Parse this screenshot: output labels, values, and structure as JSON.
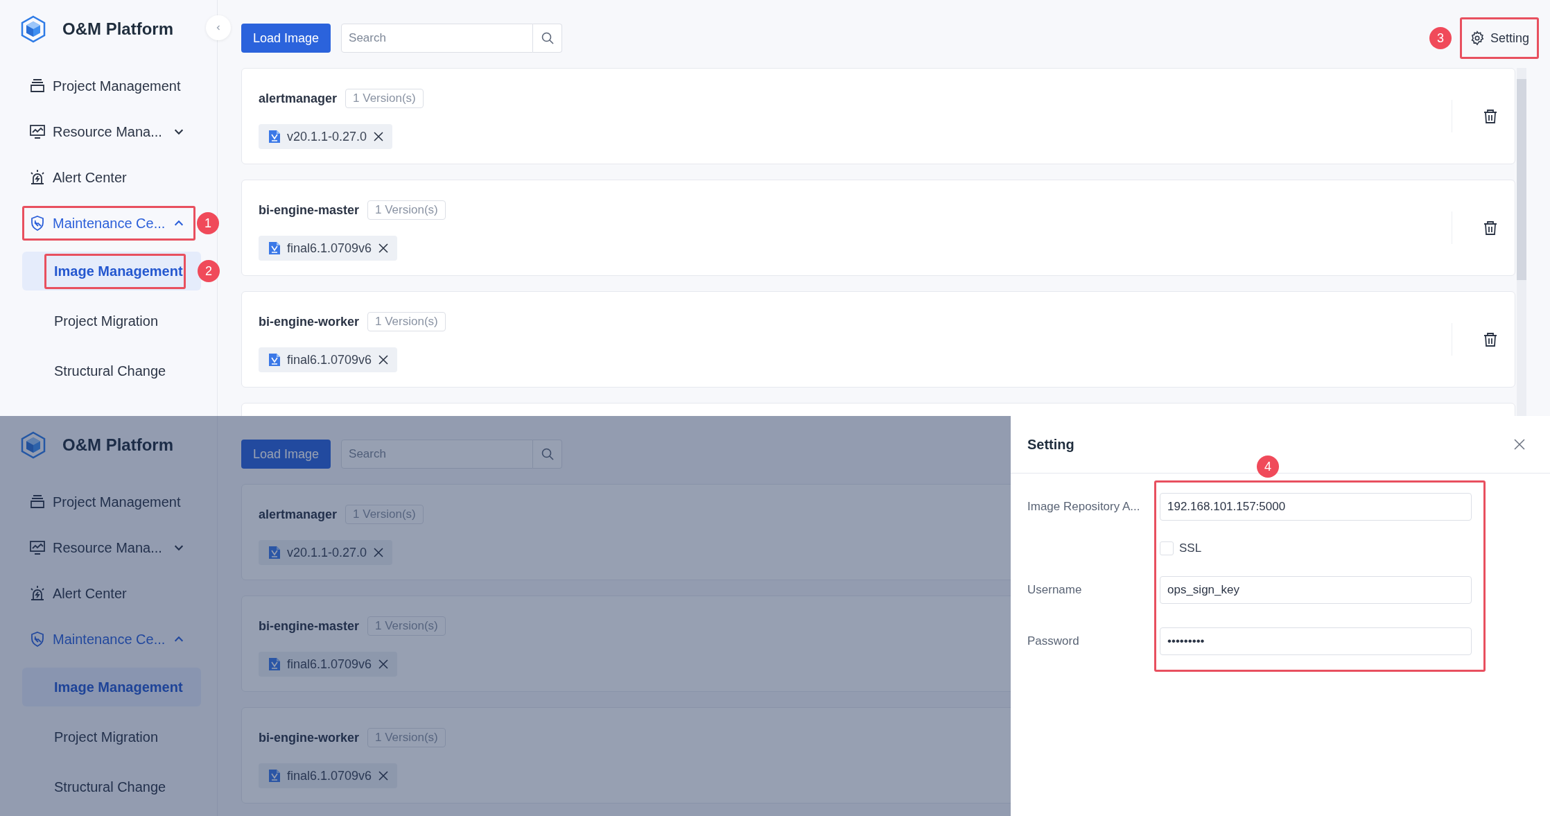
{
  "screens": [
    {
      "sidebar": {
        "title": "O&M Platform",
        "collapse_button": true,
        "menu": [
          {
            "kind": "link",
            "label": "Project Management"
          },
          {
            "kind": "group",
            "label": "Resource Mana...",
            "expanded": false
          },
          {
            "kind": "link",
            "label": "Alert Center"
          },
          {
            "kind": "group",
            "label": "Maintenance Ce...",
            "expanded": true,
            "callout": "1",
            "children": [
              {
                "label": "Image Management",
                "selected": true,
                "callout": "2"
              },
              {
                "label": "Project Migration",
                "selected": false
              },
              {
                "label": "Structural Change",
                "selected": false
              }
            ]
          }
        ]
      },
      "toolbar": {
        "load_button": "Load Image",
        "search_placeholder": "Search",
        "setting_button": {
          "label": "Setting",
          "callout": "3"
        }
      },
      "images": [
        {
          "kind": "image",
          "name": "alertmanager",
          "tag": "1 Version(s)",
          "versions": [
            "v20.1.1-0.27.0"
          ]
        },
        {
          "kind": "image",
          "name": "bi-engine-master",
          "tag": "1 Version(s)",
          "versions": [
            "final6.1.0709v6"
          ]
        },
        {
          "kind": "image",
          "name": "bi-engine-worker",
          "tag": "1 Version(s)",
          "versions": [
            "final6.1.0709v6"
          ]
        },
        {
          "kind": "empty"
        }
      ]
    },
    {
      "sidebar": {
        "title": "O&M Platform",
        "collapse_button": false,
        "menu": [
          {
            "kind": "link",
            "label": "Project Management"
          },
          {
            "kind": "group",
            "label": "Resource Mana...",
            "expanded": false
          },
          {
            "kind": "link",
            "label": "Alert Center"
          },
          {
            "kind": "group",
            "label": "Maintenance Ce...",
            "expanded": true,
            "children": [
              {
                "label": "Image Management",
                "selected": true
              },
              {
                "label": "Project Migration",
                "selected": false
              },
              {
                "label": "Structural Change",
                "selected": false
              }
            ]
          }
        ]
      },
      "toolbar": {
        "load_button": "Load Image",
        "search_placeholder": "Search"
      },
      "images": [
        {
          "kind": "image",
          "name": "alertmanager",
          "tag": "1 Version(s)",
          "versions": [
            "v20.1.1-0.27.0"
          ]
        },
        {
          "kind": "image",
          "name": "bi-engine-master",
          "tag": "1 Version(s)",
          "versions": [
            "final6.1.0709v6"
          ]
        },
        {
          "kind": "image",
          "name": "bi-engine-worker",
          "tag": "1 Version(s)",
          "versions": [
            "final6.1.0709v6"
          ]
        }
      ],
      "drawer": {
        "title": "Setting",
        "callout": "4",
        "fields": [
          {
            "kind": "text",
            "label": "Image Repository A...",
            "value": "192.168.101.157:5000"
          },
          {
            "kind": "checkbox",
            "label": "SSL",
            "checked": false
          },
          {
            "kind": "text",
            "label": "Username",
            "value": "ops_sign_key"
          },
          {
            "kind": "text",
            "label": "Password",
            "value": "•••••••••"
          }
        ]
      }
    }
  ]
}
